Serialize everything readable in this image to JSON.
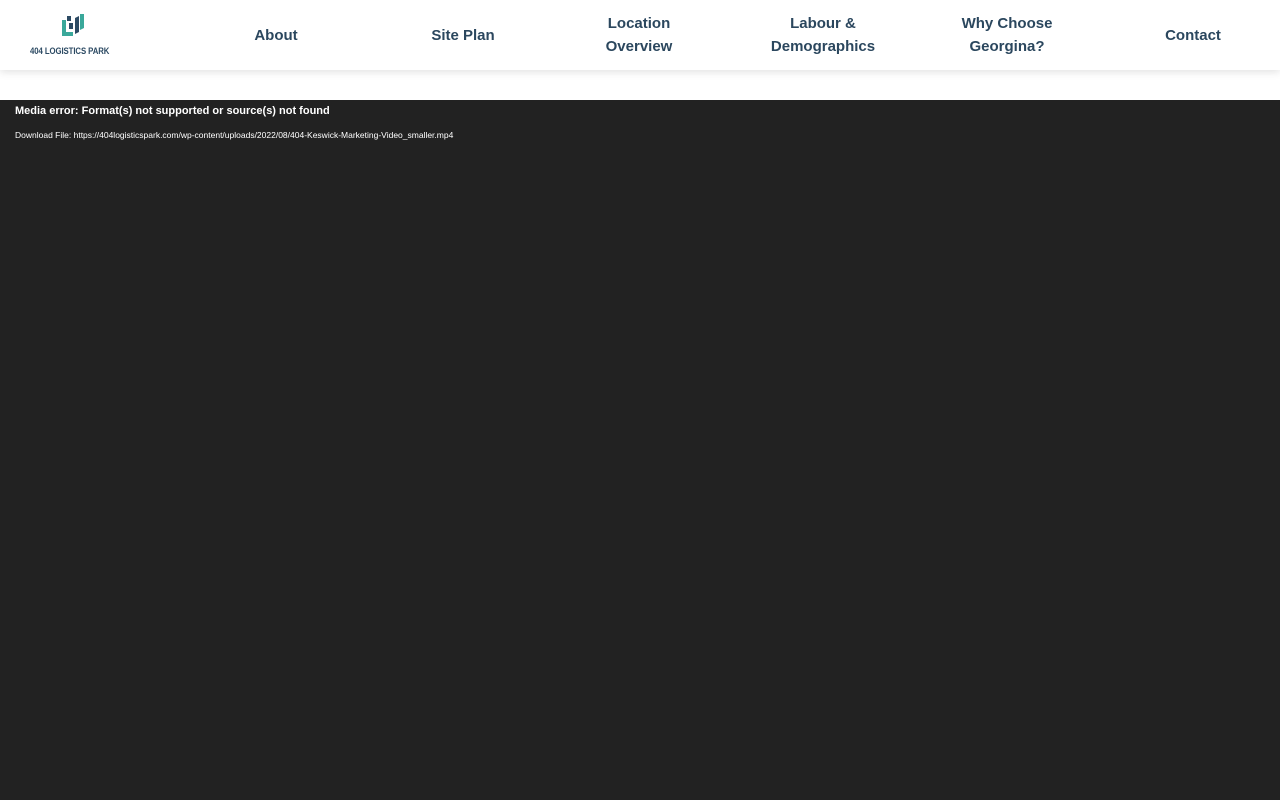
{
  "header": {
    "logo_text": "404 LOGISTICS PARK",
    "nav": [
      {
        "lines": [
          "About"
        ]
      },
      {
        "lines": [
          "Site Plan"
        ]
      },
      {
        "lines": [
          "Location",
          "Overview"
        ]
      },
      {
        "lines": [
          "Labour &",
          "Demographics"
        ]
      },
      {
        "lines": [
          "Why Choose",
          "Georgina?"
        ]
      },
      {
        "lines": [
          "Contact"
        ]
      }
    ]
  },
  "video": {
    "error_message": "Media error: Format(s) not supported or source(s) not found",
    "download_label": "Download File:",
    "download_url": "https://404logisticspark.com/wp-content/uploads/2022/08/404-Keswick-Marketing-Video_smaller.mp4"
  },
  "colors": {
    "nav_text": "#2b475e",
    "logo_teal": "#3aa89a",
    "logo_navy": "#2c4a63",
    "video_background": "#222222"
  },
  "icons": {
    "logo": "404-logistics-park-logo-mark"
  }
}
